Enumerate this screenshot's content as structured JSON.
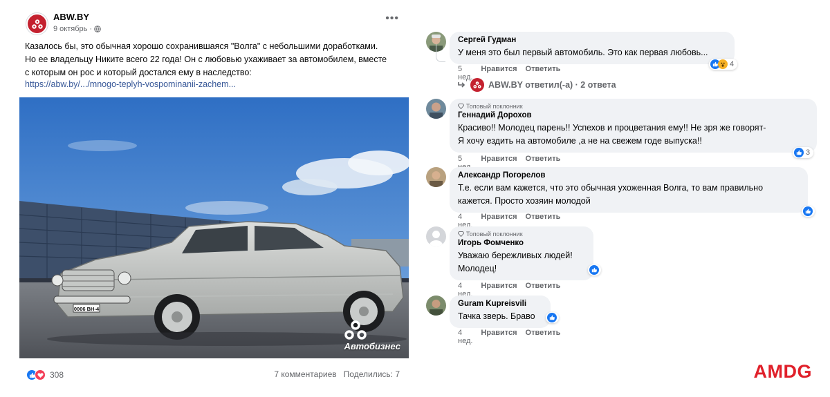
{
  "post": {
    "page_name": "ABW.BY",
    "date": "9 октябрь ·",
    "text_lines": [
      "Казалось бы, это обычная хорошо сохранившаяся \"Волга\" с небольшими доработками.",
      "Но ее владельцу Никите всего 22 года! Он с любовью ухаживает за автомобилем, вместе",
      "с которым он рос и который достался ему в наследство:"
    ],
    "link": "https://abw.by/.../mnogo-teplyh-vospominanii-zachem...",
    "image": {
      "plate": "0006 BH-4",
      "watermark": "Автобизнес"
    },
    "reaction_count": "308",
    "comments_count": "7 комментариев",
    "shares": "Поделились: 7",
    "more_icon": "•••"
  },
  "comments": [
    {
      "name": "Сергей Гудман",
      "text_lines": [
        "У меня это был первый автомобиль. Это как первая любовь..."
      ],
      "time": "5 нед.",
      "like": "Нравится",
      "reply": "Ответить",
      "reactions": "4",
      "reaction_icons": [
        "like",
        "wow"
      ]
    },
    {
      "badge": "Топовый поклонник",
      "name": "Геннадий Дорохов",
      "text_lines": [
        "Красиво!! Молодец парень!! Успехов и процветания ему!! Не зря же говорят-",
        "Я хочу ездить на автомобиле ,а не на свежем годе выпуска!!"
      ],
      "time": "5 нед.",
      "like": "Нравится",
      "reply": "Ответить",
      "reactions": "3",
      "reaction_icons": [
        "like"
      ]
    },
    {
      "name": "Александр Погорелов",
      "text_lines": [
        "Т.е. если вам кажется, что это обычная ухоженная Волга, то вам правильно",
        "кажется. Просто хозяин молодой"
      ],
      "time": "4 нед.",
      "like": "Нравится",
      "reply": "Ответить",
      "reaction_icons": [
        "like"
      ]
    },
    {
      "badge": "Топовый поклонник",
      "name": "Игорь Фомченко",
      "text_lines": [
        "Уважаю бережливых людей!",
        "Молодец!"
      ],
      "time": "4 нед.",
      "like": "Нравится",
      "reply": "Ответить",
      "reaction_icons": [
        "like"
      ]
    },
    {
      "name": "Guram Kupreisvili",
      "text_lines": [
        "Тачка зверь. Браво"
      ],
      "time": "4 нед.",
      "like": "Нравится",
      "reply": "Ответить",
      "reaction_icons": [
        "like"
      ]
    }
  ],
  "replies_link": {
    "text": "ABW.BY ответил(-а) · 2 ответа"
  },
  "brand_watermark": "AMDG",
  "colors": {
    "link": "#385898",
    "like_blue": "#1877f2",
    "love_red": "#f33e58",
    "brand_red": "#c4212f",
    "amdg_red": "#e0202a",
    "bubble_bg": "#f0f2f5",
    "meta_gray": "#65676b"
  }
}
